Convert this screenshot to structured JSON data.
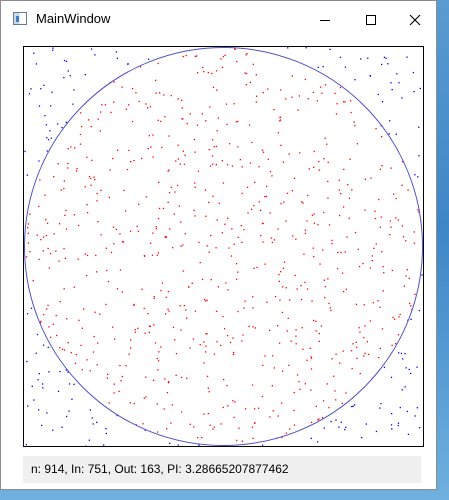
{
  "window": {
    "title": "MainWindow",
    "icon": "app-window-icon"
  },
  "controls": {
    "minimize_icon": "minimize-icon",
    "maximize_icon": "maximize-icon",
    "close_icon": "close-icon"
  },
  "simulation": {
    "n": 914,
    "inside": 751,
    "outside": 163,
    "pi_estimate": "3.28665207877462",
    "circle_color": "#5050c8",
    "inside_point_color": "#ff0000",
    "outside_point_color": "#0000ff",
    "frame_color": "#000000"
  },
  "status": {
    "text": "n: 914, In: 751, Out: 163, PI: 3.28665207877462"
  }
}
